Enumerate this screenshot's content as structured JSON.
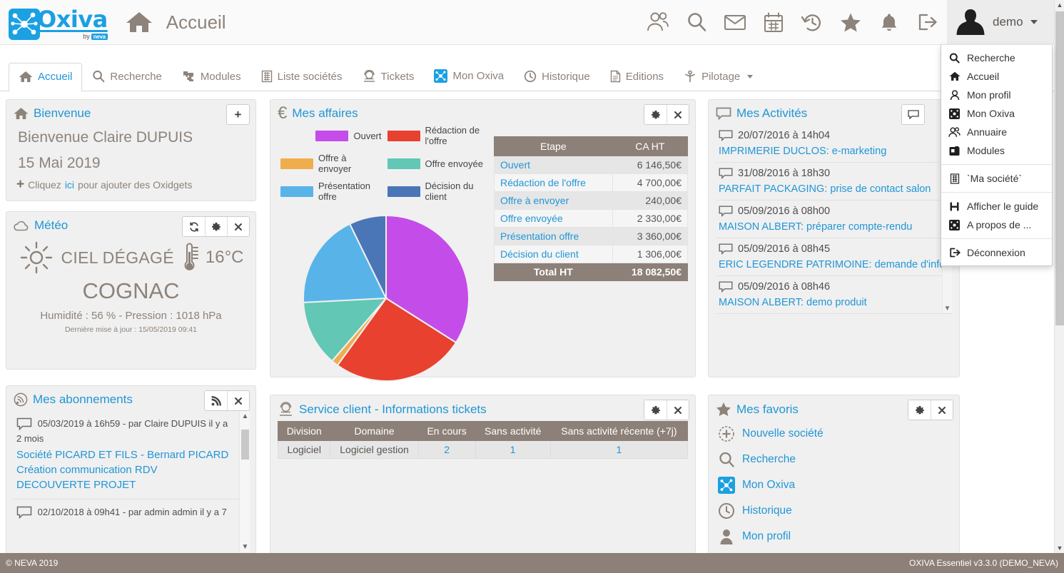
{
  "header": {
    "logo_text": "Oxiva",
    "logo_by": "by",
    "logo_brand": "neva",
    "page_title": "Accueil",
    "home_icon": "home-icon",
    "icons": [
      {
        "name": "users-icon",
        "label": "Annuaire"
      },
      {
        "name": "search-icon",
        "label": "Recherche"
      },
      {
        "name": "mail-icon",
        "label": "Messages"
      },
      {
        "name": "calendar-icon",
        "label": "Agenda"
      },
      {
        "name": "history-icon",
        "label": "Historique"
      },
      {
        "name": "star-icon",
        "label": "Favoris"
      },
      {
        "name": "bell-icon",
        "label": "Notifications"
      },
      {
        "name": "logout-icon",
        "label": "Déconnexion"
      }
    ],
    "user_name": "demo"
  },
  "tabs": [
    {
      "label": "Accueil",
      "icon": "home-icon",
      "active": true
    },
    {
      "label": "Recherche",
      "icon": "search-icon",
      "active": false
    },
    {
      "label": "Modules",
      "icon": "puzzle-icon",
      "active": false
    },
    {
      "label": "Liste sociétés",
      "icon": "building-icon",
      "active": false
    },
    {
      "label": "Tickets",
      "icon": "support-agent-icon",
      "active": false
    },
    {
      "label": "Mon Oxiva",
      "icon": "oxiva-icon",
      "active": false
    },
    {
      "label": "Historique",
      "icon": "clock-icon",
      "active": false
    },
    {
      "label": "Editions",
      "icon": "document-icon",
      "active": false
    },
    {
      "label": "Pilotage",
      "icon": "pilot-icon",
      "active": false,
      "has_caret": true
    }
  ],
  "user_menu": {
    "groups": [
      [
        {
          "label": "Recherche",
          "icon": "search-icon"
        },
        {
          "label": "Accueil",
          "icon": "home-icon"
        },
        {
          "label": "Mon profil",
          "icon": "person-icon"
        },
        {
          "label": "Mon Oxiva",
          "icon": "oxiva-icon"
        },
        {
          "label": "Annuaire",
          "icon": "users-icon"
        },
        {
          "label": "Modules",
          "icon": "modules-icon"
        }
      ],
      [
        {
          "label": "`Ma société`",
          "icon": "building-icon"
        }
      ],
      [
        {
          "label": "Afficher le guide",
          "icon": "book-icon"
        },
        {
          "label": "A propos de ...",
          "icon": "oxiva-icon"
        }
      ],
      [
        {
          "label": "Déconnexion",
          "icon": "logout-icon"
        }
      ]
    ]
  },
  "bienvenue": {
    "title": "Bienvenue",
    "icon": "home-icon",
    "add_button": "+",
    "greeting": "Bienvenue Claire DUPUIS",
    "date": "15 Mai 2019",
    "oxidget_prefix": "Cliquez",
    "oxidget_link": "ici",
    "oxidget_suffix": "pour ajouter des Oxidgets"
  },
  "meteo": {
    "title": "Météo",
    "icon": "cloud-icon",
    "buttons": [
      "refresh-icon",
      "gear-icon",
      "close-icon"
    ],
    "condition": "CIEL DÉGAGÉ",
    "temperature": "16°C",
    "city": "COGNAC",
    "details": "Humidité : 56 % - Pression : 1018 hPa",
    "updated": "Dernière mise à jour : 15/05/2019 09:41"
  },
  "affaires": {
    "title": "Mes affaires",
    "icon": "euro-icon",
    "buttons": [
      "gear-icon",
      "close-icon"
    ],
    "columns": [
      "Etape",
      "CA HT"
    ],
    "rows": [
      {
        "label": "Ouvert",
        "value": "6 146,50€"
      },
      {
        "label": "Rédaction de l'offre",
        "value": "4 700,00€"
      },
      {
        "label": "Offre à envoyer",
        "value": "240,00€"
      },
      {
        "label": "Offre envoyée",
        "value": "2 330,00€"
      },
      {
        "label": "Présentation offre",
        "value": "3 360,00€"
      },
      {
        "label": "Décision du client",
        "value": "1 306,00€"
      }
    ],
    "total_label": "Total HT",
    "total_value": "18 082,50€"
  },
  "chart_data": {
    "type": "pie",
    "title": "Mes affaires",
    "categories": [
      "Ouvert",
      "Rédaction de l'offre",
      "Offre à envoyer",
      "Offre envoyée",
      "Présentation offre",
      "Décision du client"
    ],
    "values": [
      6146.5,
      4700.0,
      240.0,
      2330.0,
      3360.0,
      1306.0
    ],
    "value_labels": [
      "6 146,50€",
      "4 700,00€",
      "240,00€",
      "2 330,00€",
      "3 360,00€",
      "1 306,00€"
    ],
    "total": 18082.5,
    "total_label": "18 082,50€",
    "colors": [
      "#c44ce8",
      "#e8412f",
      "#f0ad4e",
      "#62c7b4",
      "#58b4e8",
      "#4a76b8"
    ],
    "legend_position": "top",
    "unit": "€",
    "xlabel": "",
    "ylabel": "CA HT"
  },
  "activites": {
    "title": "Mes Activités",
    "icon": "comment-icon",
    "buttons": [
      "comment-icon"
    ],
    "items": [
      {
        "date": "20/07/2016 à 14h04",
        "link": "IMPRIMERIE DUCLOS: e-marketing"
      },
      {
        "date": "31/08/2016 à 18h30",
        "link": "PARFAIT PACKAGING: prise de contact salon"
      },
      {
        "date": "05/09/2016 à 08h00",
        "link": "MAISON ALBERT: préparer compte-rendu"
      },
      {
        "date": "05/09/2016 à 08h45",
        "link": "ERIC LEGENDRE PATRIMOINE: demande d'info"
      },
      {
        "date": "05/09/2016 à 08h46",
        "link": "MAISON ALBERT: demo produit"
      }
    ]
  },
  "abonnements": {
    "title": "Mes abonnements",
    "icon": "rss-icon",
    "buttons": [
      "rss-icon",
      "close-icon"
    ],
    "items": [
      {
        "meta": "05/03/2019 à 16h59 - par Claire DUPUIS il y a 2 mois",
        "link": "Société PICARD ET FILS - Bernard PICARD Création communication RDV DECOUVERTE PROJET"
      },
      {
        "meta": "02/10/2018 à 09h41 - par admin admin il y a 7",
        "link": ""
      }
    ]
  },
  "tickets": {
    "title": "Service client - Informations tickets",
    "icon": "support-agent-icon",
    "buttons": [
      "gear-icon",
      "close-icon"
    ],
    "columns": [
      "Division",
      "Domaine",
      "En cours",
      "Sans activité",
      "Sans activité récente (+7j)"
    ],
    "rows": [
      {
        "division": "Logiciel",
        "domaine": "Logiciel gestion",
        "en_cours": "2",
        "sans_activite": "1",
        "sans_activite_recente": "1"
      }
    ]
  },
  "favoris": {
    "title": "Mes favoris",
    "icon": "star-icon",
    "buttons": [
      "gear-icon",
      "close-icon"
    ],
    "items": [
      {
        "label": "Nouvelle société",
        "icon": "plus-circle-icon"
      },
      {
        "label": "Recherche",
        "icon": "search-icon"
      },
      {
        "label": "Mon Oxiva",
        "icon": "oxiva-icon"
      },
      {
        "label": "Historique",
        "icon": "clock-icon"
      },
      {
        "label": "Mon profil",
        "icon": "person-icon"
      }
    ]
  },
  "footer": {
    "left": "© NEVA 2019",
    "right": "OXIVA Essentiel v3.3.0 (DEMO_NEVA)"
  },
  "colors": {
    "accent": "#2196d6",
    "brand": "#1ba0e2",
    "muted": "#8d837a",
    "table_header": "#8c8078"
  }
}
